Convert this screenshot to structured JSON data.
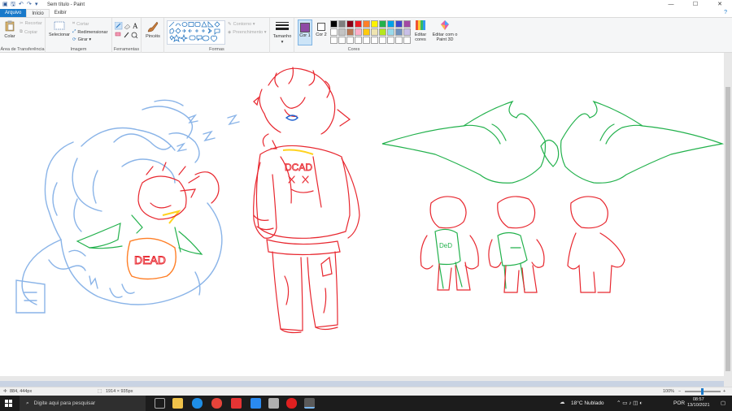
{
  "window": {
    "title": "Sem título - Paint",
    "controls": {
      "minimize": "—",
      "maximize": "☐",
      "close": "✕"
    }
  },
  "tabs": [
    {
      "label": "Arquivo",
      "active": false
    },
    {
      "label": "Início",
      "active": true
    },
    {
      "label": "Exibir",
      "active": false
    }
  ],
  "ribbon": {
    "clipboard": {
      "label": "Área de Transferência",
      "paste": "Colar",
      "cut": "Recortar",
      "copy": "Copiar"
    },
    "image": {
      "label": "Imagem",
      "select": "Selecionar",
      "crop": "Cortar",
      "resize": "Redimensionar",
      "rotate": "Girar ▾"
    },
    "tools": {
      "label": "Ferramentas"
    },
    "brushes": {
      "label": "Pincéis"
    },
    "shapes": {
      "label": "Formas",
      "outline": "Contorno ▾",
      "fill": "Preenchimento ▾"
    },
    "size": {
      "label": "Tamanho"
    },
    "colors": {
      "label": "Cores",
      "color1": "Cor 1",
      "color2": "Cor 2",
      "edit": "Editar cores",
      "paint3d": "Editar com o Paint 3D",
      "color1_value": "#8f4aa5",
      "color2_value": "#ffffff",
      "palette_row1": [
        "#000000",
        "#7f7f7f",
        "#880015",
        "#ed1c24",
        "#ff7f27",
        "#fff200",
        "#22b14c",
        "#00a2e8",
        "#3f48cc",
        "#a349a4"
      ],
      "palette_row2": [
        "#ffffff",
        "#c3c3c3",
        "#b97a57",
        "#ffaec9",
        "#ffc90e",
        "#efe4b0",
        "#b5e61d",
        "#99d9ea",
        "#7092be",
        "#c8bfe7"
      ],
      "palette_row3": [
        "#ffffff",
        "#ffffff",
        "#ffffff",
        "#ffffff",
        "#ffffff",
        "#ffffff",
        "#ffffff",
        "#ffffff",
        "#ffffff",
        "#ffffff"
      ]
    }
  },
  "canvas": {
    "drawing_colors": {
      "blue": "#8ab4e8",
      "red": "#e8272f",
      "green": "#22b14c",
      "orange": "#ff7f27",
      "yellow": "#ffd21f"
    },
    "labels": {
      "dead1": "DEAD",
      "dead2": "DCAD",
      "dead3": "DeD"
    }
  },
  "status": {
    "cursor": "884, 444px",
    "size": "1914 × 935px",
    "zoom": "100%"
  },
  "taskbar": {
    "search_placeholder": "Digite aqui para pesquisar",
    "weather": "18°C  Nublado",
    "lang": "POR",
    "time": "08:57",
    "date": "13/10/2021"
  }
}
